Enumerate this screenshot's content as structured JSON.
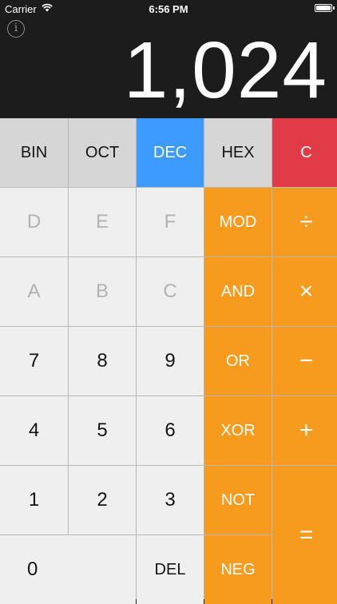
{
  "status": {
    "carrier": "Carrier",
    "time": "6:56 PM"
  },
  "info": {
    "symbol": "i"
  },
  "display": {
    "value": "1,024"
  },
  "modes": [
    {
      "label": "BIN",
      "active": false
    },
    {
      "label": "OCT",
      "active": false
    },
    {
      "label": "DEC",
      "active": true
    },
    {
      "label": "HEX",
      "active": false
    }
  ],
  "clear_label": "C",
  "hex_digits": [
    "D",
    "E",
    "F",
    "A",
    "B",
    "C"
  ],
  "digits": [
    "7",
    "8",
    "9",
    "4",
    "5",
    "6",
    "1",
    "2",
    "3",
    "0"
  ],
  "del_label": "DEL",
  "bitwise_ops": [
    "MOD",
    "AND",
    "OR",
    "XOR",
    "NOT",
    "NEG"
  ],
  "arith_ops": [
    "÷",
    "×",
    "−",
    "+",
    "="
  ],
  "colors": {
    "background": "#1c1c1c",
    "mode_active": "#3d9bff",
    "clear": "#e13b47",
    "operator": "#f79b1e",
    "key": "#efefef"
  }
}
